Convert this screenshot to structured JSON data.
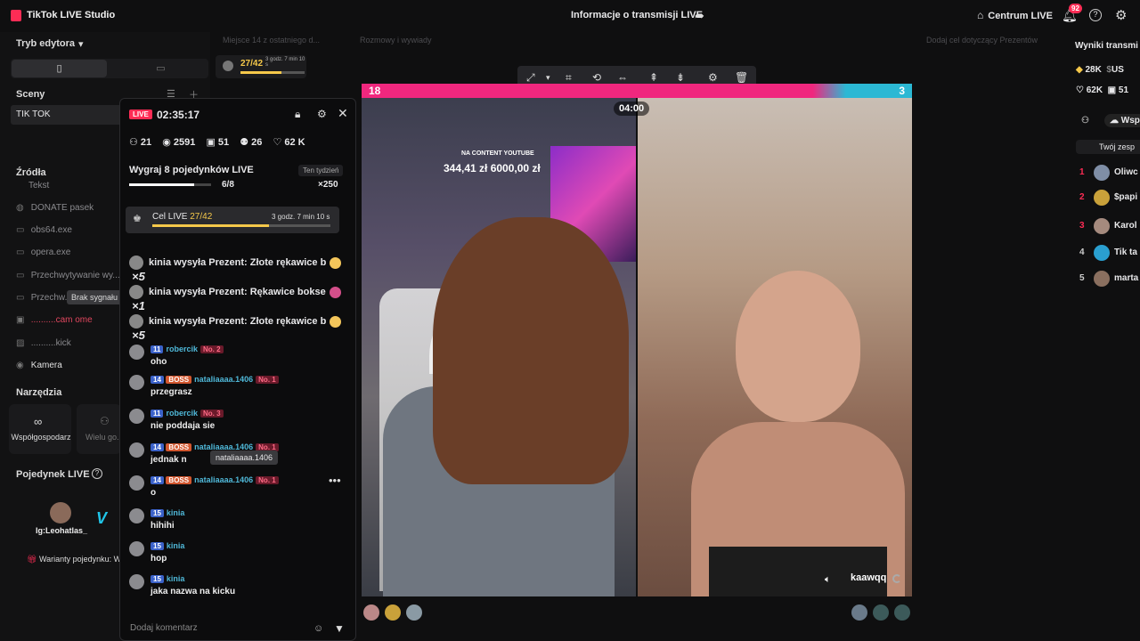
{
  "app": {
    "title": "TikTok LIVE Studio",
    "center_title": "Informacje o transmisji LIVE",
    "hub_label": "Centrum LIVE",
    "notifications": "92"
  },
  "sidebar": {
    "mode_label": "Tryb edytora",
    "scenes_label": "Sceny",
    "scene": "TIK TOK",
    "sources_label": "Źródła",
    "sources": [
      "Tekst",
      "DONATE pasek",
      "obs64.exe",
      "opera.exe",
      "Przechwytywanie wy...",
      "Przechw...",
      "..........cam ome",
      "..........kick",
      "Kamera"
    ],
    "tooltip": "Brak sygnału",
    "tools_label": "Narzędzia",
    "tools": [
      "Współgospodarz",
      "Wielu go..."
    ],
    "duel_label": "Pojedynek LIVE",
    "duel_user": "Ig:Leohatlas_",
    "duel_partner": "kaawqq",
    "duel_variants": "Warianty pojedynku: Wszystkie prezenty"
  },
  "strip": {
    "place": "Miejsce 14 z ostatniego d...",
    "talk": "Rozmowy i wywiady",
    "goal_prompt": "Dodaj cel dotyczący Prezentów",
    "mini_goal": "27/42",
    "mini_time": "3 godz. 7 min 10 s"
  },
  "panel": {
    "live_badge": "LIVE",
    "live_time": "02:35:17",
    "stats": {
      "viewers": "21",
      "views": "2591",
      "gifts": "51",
      "new": "26",
      "likes": "62 K"
    },
    "goal_title": "Wygraj 8 pojedynków LIVE",
    "goal_week": "Ten tydzień",
    "goal_count": "6/8",
    "goal_reward": "×250",
    "cel_label": "Cel LIVE",
    "cel_value": "27/42",
    "cel_time": "3 godz. 7 min 10 s",
    "gifts": [
      {
        "user": "kinia",
        "text": "wysyła Prezent: Złote rękawice b",
        "mult": "×5"
      },
      {
        "user": "kinia",
        "text": "wysyła Prezent: Rękawice bokse",
        "mult": "×1"
      },
      {
        "user": "kinia",
        "text": "wysyła Prezent: Złote rękawice b",
        "mult": "×5"
      }
    ],
    "comments": [
      {
        "lvl": "11",
        "boss": "",
        "user": "robercik",
        "no": "No. 2",
        "msg": "oho"
      },
      {
        "lvl": "14",
        "boss": "BOSS",
        "user": "nataliaaaa.1406",
        "no": "No. 1",
        "msg": "przegrasz"
      },
      {
        "lvl": "11",
        "boss": "",
        "user": "robercik",
        "no": "No. 3",
        "msg": "nie poddaja sie"
      },
      {
        "lvl": "14",
        "boss": "BOSS",
        "user": "nataliaaaa.1406",
        "no": "No. 1",
        "msg": "jednak n"
      },
      {
        "lvl": "14",
        "boss": "BOSS",
        "user": "nataliaaaa.1406",
        "no": "No. 1",
        "msg": "o"
      },
      {
        "lvl": "15",
        "boss": "",
        "user": "kinia",
        "no": "",
        "msg": "hihihi"
      },
      {
        "lvl": "15",
        "boss": "",
        "user": "kinia",
        "no": "",
        "msg": "hop"
      },
      {
        "lvl": "15",
        "boss": "",
        "user": "kinia",
        "no": "",
        "msg": "jaka nazwa na kicku"
      }
    ],
    "user_tooltip": "nataliaaaa.1406",
    "comment_placeholder": "Dodaj komentarz"
  },
  "video": {
    "score_left": "18",
    "score_right": "3",
    "timer": "04:00",
    "yt_label": "NA CONTENT YOUTUBE",
    "yt_amount": "344,41 zł  6000,00 zł",
    "opponent": "kaawqq"
  },
  "right": {
    "title": "Wyniki transmi",
    "v1": "28K",
    "v1b": "US",
    "v2": "62K",
    "v2b": "51",
    "tab": "Wsp",
    "team": "Twój zesp",
    "ranks": [
      {
        "n": "1",
        "name": "Oliwc"
      },
      {
        "n": "2",
        "name": "$papi"
      },
      {
        "n": "3",
        "name": "Karol"
      },
      {
        "n": "4",
        "name": "Tik ta"
      },
      {
        "n": "5",
        "name": "marta"
      }
    ]
  },
  "colors": {
    "accent": "#fe2c55",
    "team_left": "#f0277e",
    "team_right": "#2bb8d4",
    "goal": "#f5c84a"
  }
}
